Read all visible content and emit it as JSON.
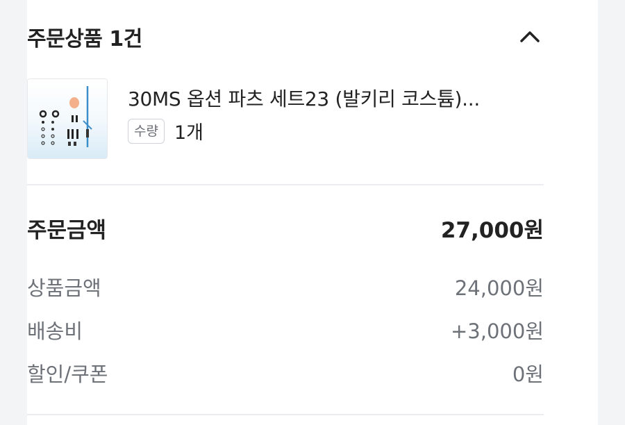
{
  "header": {
    "title": "주문상품 1건"
  },
  "product": {
    "name": "30MS 옵션 파츠 세트23 (발키리 코스튬)...",
    "quantity_label": "수량",
    "quantity_value": "1개"
  },
  "summary": {
    "total_label": "주문금액",
    "total_value": "27,000원",
    "items": [
      {
        "label": "상품금액",
        "value": "24,000원"
      },
      {
        "label": "배송비",
        "value": "+3,000원"
      },
      {
        "label": "할인/쿠폰",
        "value": "0원"
      }
    ]
  },
  "colors": {
    "text_primary": "#222222",
    "text_secondary": "#6d7178",
    "divider": "#ebedf0",
    "background": "#f3f4f6"
  }
}
